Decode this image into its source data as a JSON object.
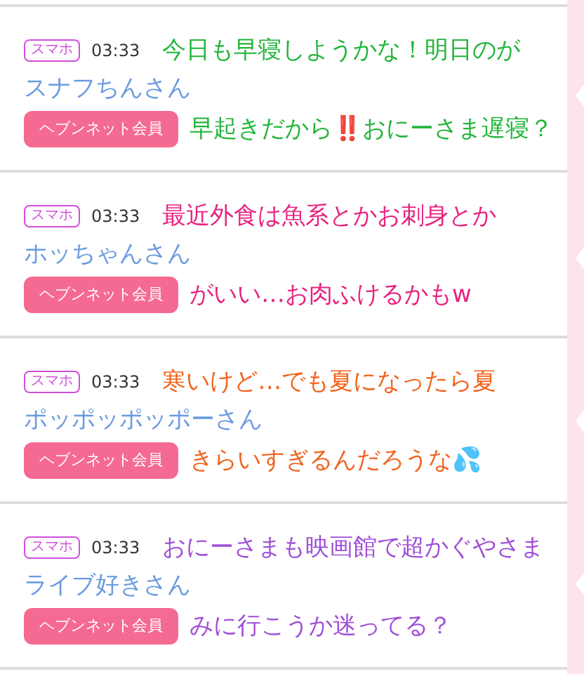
{
  "posts": [
    {
      "tag": "スマホ",
      "time": "03:33",
      "name": "スナフちんさん",
      "badge": "ヘブンネット会員",
      "color": "#22b53a",
      "caption": [
        "今日も早寝しようかな！明日のが",
        "早起きだから‼️おにーさま遅寝？"
      ]
    },
    {
      "tag": "スマホ",
      "time": "03:33",
      "name": "ホッちゃんさん",
      "badge": "ヘブンネット会員",
      "color": "#e8237f",
      "caption": [
        "最近外食は魚系とかお刺身とか",
        "がいい…お肉ふけるかもw"
      ]
    },
    {
      "tag": "スマホ",
      "time": "03:33",
      "name": "ポッポッポッポーさん",
      "badge": "ヘブンネット会員",
      "color": "#f0641e",
      "caption": [
        "寒いけど…でも夏になったら夏",
        "きらいすぎるんだろうな💦"
      ]
    },
    {
      "tag": "スマホ",
      "time": "03:33",
      "name": "ライブ好きさん",
      "badge": "ヘブンネット会員",
      "color": "#a050d8",
      "caption": [
        "おにーさまも映画館で超かぐやさま",
        "みに行こうか迷ってる？"
      ]
    }
  ]
}
